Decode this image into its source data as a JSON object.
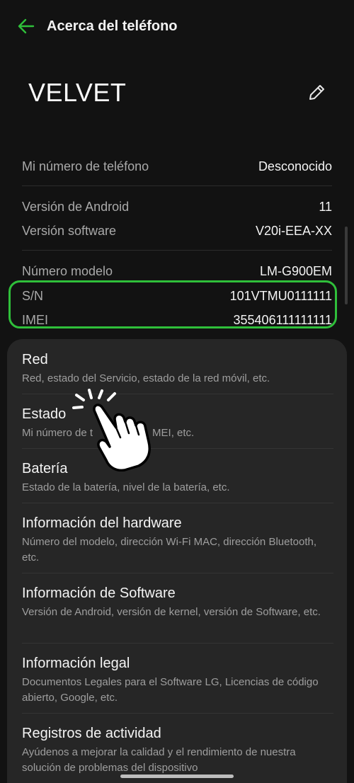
{
  "header": {
    "title": "Acerca del teléfono"
  },
  "device": {
    "name": "VELVET"
  },
  "info": {
    "phone_label": "Mi número de teléfono",
    "phone_value": "Desconocido",
    "android_label": "Versión de Android",
    "android_value": "11",
    "software_label": "Versión software",
    "software_value": "V20i-EEA-XX",
    "model_label": "Número modelo",
    "model_value": "LM-G900EM",
    "sn_label": "S/N",
    "sn_value": "101VTMU0111111",
    "imei_label": "IMEI",
    "imei_value": "355406111111111"
  },
  "menu": [
    {
      "title": "Red",
      "subtitle": "Red, estado del Servicio, estado de la red móvil, etc."
    },
    {
      "title": "Estado",
      "subtitle": "Mi número de t",
      "subtitle_tail": "MEI, etc."
    },
    {
      "title": "Batería",
      "subtitle": "Estado de la batería, nivel de la batería, etc."
    },
    {
      "title": "Información del hardware",
      "subtitle": "Número del modelo, dirección Wi-Fi MAC, dirección Bluetooth, etc."
    },
    {
      "title": "Información de Software",
      "subtitle": "Versión de Android, versión de kernel, versión de Software, etc."
    },
    {
      "title": "Información legal",
      "subtitle": "Documentos Legales para el Software LG, Licencias de código abierto, Google, etc."
    },
    {
      "title": "Registros de actividad",
      "subtitle": "Ayúdenos a mejorar la calidad y el rendimiento de nuestra solución de problemas del dispositivo"
    }
  ],
  "colors": {
    "accent": "#2fbf3a",
    "background": "#121212",
    "card": "#262626"
  },
  "icons": {
    "back": "arrow-left-icon",
    "edit": "pencil-icon",
    "hand": "tap-hand-icon"
  }
}
